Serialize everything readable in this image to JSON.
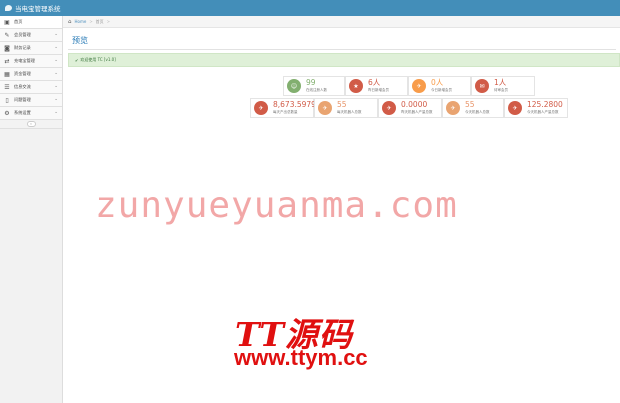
{
  "app": {
    "title": "当电宝管理系统"
  },
  "sidebar": {
    "items": [
      {
        "label": "首页",
        "icon": "dashboard-icon",
        "glyph": "▣",
        "active": true,
        "has_children": false
      },
      {
        "label": "会员管理",
        "icon": "edit-icon",
        "glyph": "✎",
        "active": false,
        "has_children": true
      },
      {
        "label": "财务记录",
        "icon": "coins-icon",
        "glyph": "◙",
        "active": false,
        "has_children": true
      },
      {
        "label": "充电宝管理",
        "icon": "shuffle-icon",
        "glyph": "⇄",
        "active": false,
        "has_children": true
      },
      {
        "label": "资金管理",
        "icon": "calendar-icon",
        "glyph": "▦",
        "active": false,
        "has_children": true
      },
      {
        "label": "信息交流",
        "icon": "list-icon",
        "glyph": "☰",
        "active": false,
        "has_children": true
      },
      {
        "label": "问题管理",
        "icon": "file-icon",
        "glyph": "▯",
        "active": false,
        "has_children": true
      },
      {
        "label": "系统设置",
        "icon": "gear-icon",
        "glyph": "⚙",
        "active": false,
        "has_children": true
      }
    ],
    "collapse_glyph": "«"
  },
  "breadcrumb": {
    "home": "Home",
    "separator": ">",
    "current": "首页",
    "trail_end": ">"
  },
  "page": {
    "title": "预览"
  },
  "alert": {
    "check": "✔",
    "text": "欢迎使用 TC  [v1.0]"
  },
  "stats_row1": [
    {
      "value": "99",
      "label": "在线注册人数",
      "color": "green",
      "glyph": "☺"
    },
    {
      "value": "6人",
      "label": "昨日新增会员",
      "color": "red",
      "glyph": "★"
    },
    {
      "value": "0人",
      "label": "今日新增会员",
      "color": "orange",
      "glyph": "✈"
    },
    {
      "value": "1人",
      "label": "待审会员",
      "color": "red",
      "glyph": "✉"
    }
  ],
  "stats_row2": [
    {
      "value": "8,673.5979",
      "label": "每天产出总数量",
      "color": "red",
      "glyph": "✈"
    },
    {
      "value": "55",
      "label": "每天机器人总数",
      "color": "peach",
      "glyph": "✈"
    },
    {
      "value": "0.0000",
      "label": "昨天机器人产量总数",
      "color": "red",
      "glyph": "✈"
    },
    {
      "value": "55",
      "label": "今天机器人总数",
      "color": "peach",
      "glyph": "✈"
    },
    {
      "value": "125.2800",
      "label": "今天机器人产量总数",
      "color": "red",
      "glyph": "✈"
    }
  ],
  "watermarks": {
    "site": "zunyueyuanma.com",
    "logo": "TT源码",
    "url": "www.ttym.cc"
  },
  "colors": {
    "topbar": "#438eb9",
    "green": "#82af6f",
    "red": "#d15b47",
    "orange": "#f89c4a",
    "alert_bg": "#dff0d8",
    "title": "#2679b5"
  }
}
